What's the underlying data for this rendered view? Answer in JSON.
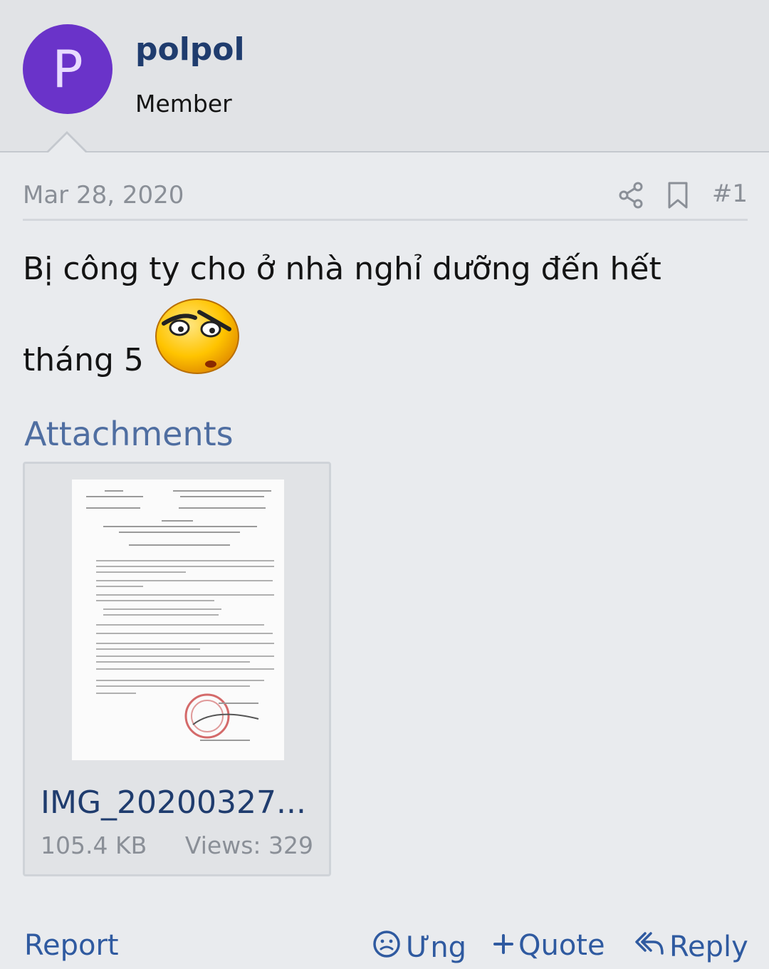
{
  "user": {
    "avatar_letter": "P",
    "name": "polpol",
    "title": "Member"
  },
  "post": {
    "date": "Mar 28, 2020",
    "number": "#1",
    "message_line1": "Bị công ty cho ở nhà nghỉ dưỡng đến hết",
    "message_line2": "tháng 5"
  },
  "attachments": {
    "title": "Attachments",
    "items": [
      {
        "name": "IMG_20200327...",
        "size": "105.4 KB",
        "views": "Views: 329"
      }
    ]
  },
  "footer": {
    "report": "Report",
    "react": "Ưng",
    "quote": "Quote",
    "reply": "Reply"
  },
  "colors": {
    "avatar_bg": "#6a33c9",
    "link": "#2f5aa0",
    "username": "#1f3c6e",
    "muted": "#8a8f97"
  },
  "icons": [
    "share-icon",
    "bookmark-icon",
    "sad-smiley-icon",
    "react-face-icon",
    "plus-icon",
    "reply-arrow-icon"
  ]
}
